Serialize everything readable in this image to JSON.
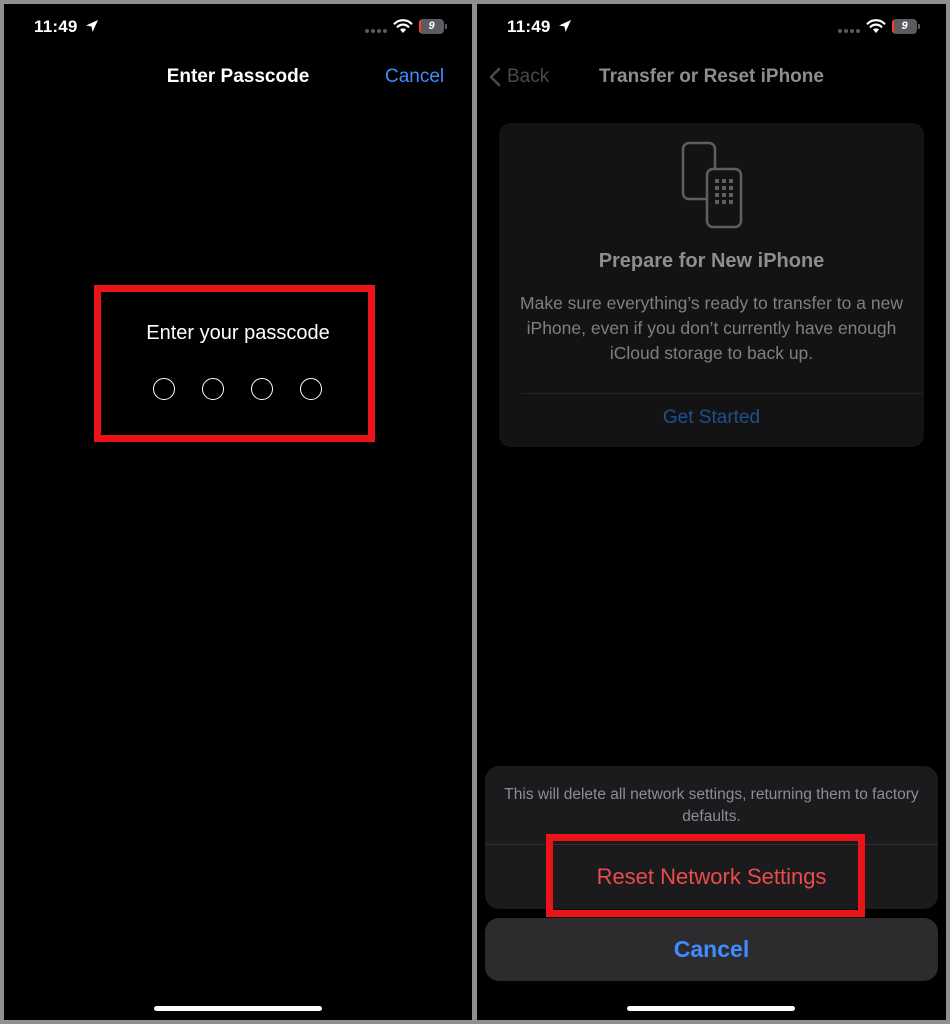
{
  "left": {
    "status": {
      "time": "11:49",
      "battery": "9",
      "battery_level": 0.09
    },
    "nav": {
      "title": "Enter Passcode",
      "cancel": "Cancel"
    },
    "passcode": {
      "prompt": "Enter your passcode",
      "digits": 4
    }
  },
  "right": {
    "status": {
      "time": "11:49",
      "battery": "9",
      "battery_level": 0.09
    },
    "nav": {
      "back": "Back",
      "title": "Transfer or Reset iPhone"
    },
    "card": {
      "title": "Prepare for New iPhone",
      "description": "Make sure everything’s ready to transfer to a new iPhone, even if you don’t currently have enough iCloud storage to back up.",
      "link": "Get Started"
    },
    "sheet": {
      "message": "This will delete all network settings, returning them to factory defaults.",
      "action": "Reset Network Settings",
      "cancel": "Cancel"
    }
  },
  "colors": {
    "accent": "#3f8cff",
    "destructive": "#eb4b4b",
    "highlight": "#e8141a",
    "background": "#000000"
  },
  "icons": [
    "location-arrow-icon",
    "cellular-dots-icon",
    "wifi-icon",
    "battery-icon",
    "chevron-left-icon",
    "phones-transfer-icon"
  ]
}
